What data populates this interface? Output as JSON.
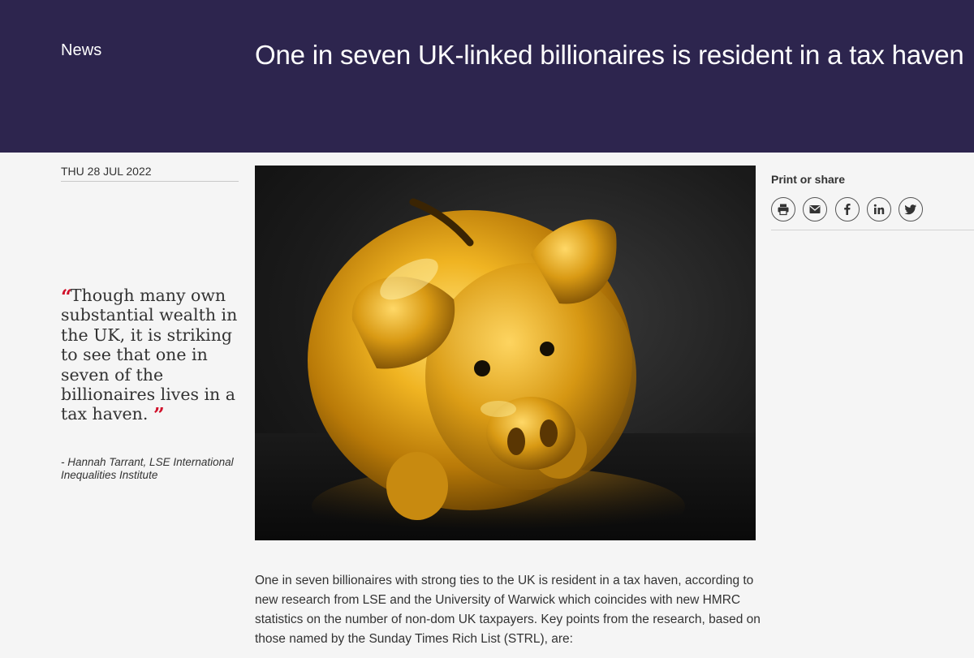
{
  "header": {
    "section": "News",
    "title": "One in seven UK-linked billionaires is resident in a tax haven"
  },
  "article": {
    "date": "THU 28 JUL 2022",
    "quote": {
      "open_mark": "“",
      "text": "Though many own substantial wealth in the UK, it is striking to see that one in seven of the billionaires lives in a tax haven.",
      "close_mark": "”",
      "attribution": "- Hannah Tarrant, LSE International Inequalities Institute"
    },
    "hero_image": {
      "subject": "golden piggy bank"
    },
    "intro": "One in seven billionaires with strong ties to the UK is resident in a tax haven, according to new research from LSE and the University of Warwick which coincides with new HMRC statistics on the number of non-dom UK taxpayers. Key points from the research, based on those named by the Sunday Times Rich List (STRL), are:"
  },
  "share": {
    "label": "Print or share",
    "buttons": [
      {
        "icon": "print-icon"
      },
      {
        "icon": "email-icon"
      },
      {
        "icon": "facebook-icon"
      },
      {
        "icon": "linkedin-icon"
      },
      {
        "icon": "twitter-icon"
      }
    ]
  },
  "colors": {
    "banner": "#2d254e",
    "quote_mark": "#d0102a",
    "background": "#f5f5f5"
  }
}
